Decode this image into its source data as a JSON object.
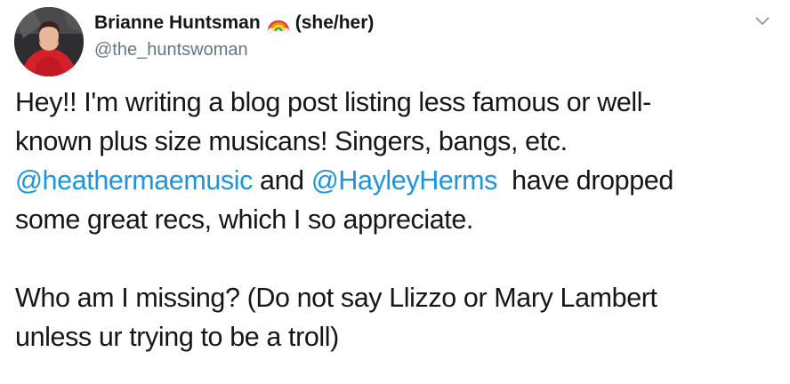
{
  "author": {
    "display_name": "Brianne Huntsman",
    "pronouns": "(she/her)",
    "handle": "@the_huntswoman",
    "name_emoji": "rainbow-emoji"
  },
  "icons": {
    "more": "chevron-down-icon"
  },
  "colors": {
    "text": "#14171a",
    "secondary": "#657786",
    "link": "#1b95e0"
  },
  "tweet": {
    "line1": "Hey!! I'm writing a blog post listing less famous or well-",
    "line2": "known plus size musicans!  Singers, bangs, etc.",
    "mention1": "@heathermaemusic",
    "line3_mid": " and ",
    "mention2": "@HayleyHerms",
    "line3_end": "  have dropped",
    "line4": "some great recs, which I so appreciate.",
    "line6": "Who am I missing? (Do not say Llizzo or Mary Lambert",
    "line7": "unless ur trying to be a troll)"
  }
}
